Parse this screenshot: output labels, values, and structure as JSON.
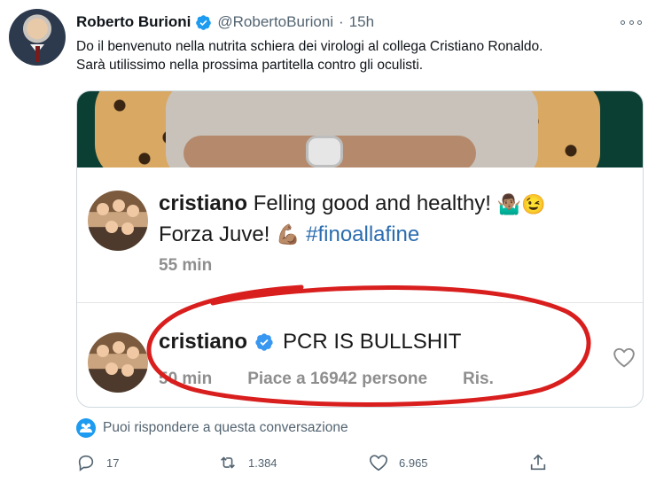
{
  "tweet": {
    "author_name": "Roberto Burioni",
    "author_handle": "@RobertoBurioni",
    "separator": "·",
    "timestamp": "15h",
    "text_line1": "Do il benvenuto nella nutrita schiera dei virologi al collega Cristiano Ronaldo.",
    "text_line2": "Sarà utilissimo nella prossima partitella contro gli oculisti."
  },
  "embedded": {
    "post": {
      "username": "cristiano",
      "text_part1": " Felling good and healthy! ",
      "emoji_shrug": "🤷🏽‍♂️",
      "emoji_wink": "😉",
      "text_part2": "Forza Juve! ",
      "emoji_muscle": "💪🏽",
      "hashtag": "#finoallafine",
      "time": "55 min"
    },
    "reply": {
      "username": "cristiano",
      "text": "PCR IS BULLSHIT",
      "time": "50 min",
      "likes": "Piace a 16942 persone",
      "reply_label": "Ris."
    }
  },
  "conversation": {
    "label": "Puoi rispondere a questa conversazione"
  },
  "actions": {
    "replies": "17",
    "retweets": "1.384",
    "likes": "6.965"
  },
  "colors": {
    "verified": "#1d9bf0",
    "hashtag": "#2b6cb0",
    "annotation_circle": "#d91e1e"
  },
  "icons": {
    "verified": "verified-badge-icon",
    "more": "more-dots-icon",
    "reply": "reply-icon",
    "retweet": "retweet-icon",
    "like": "heart-icon",
    "share": "share-icon",
    "conversation": "people-icon"
  }
}
